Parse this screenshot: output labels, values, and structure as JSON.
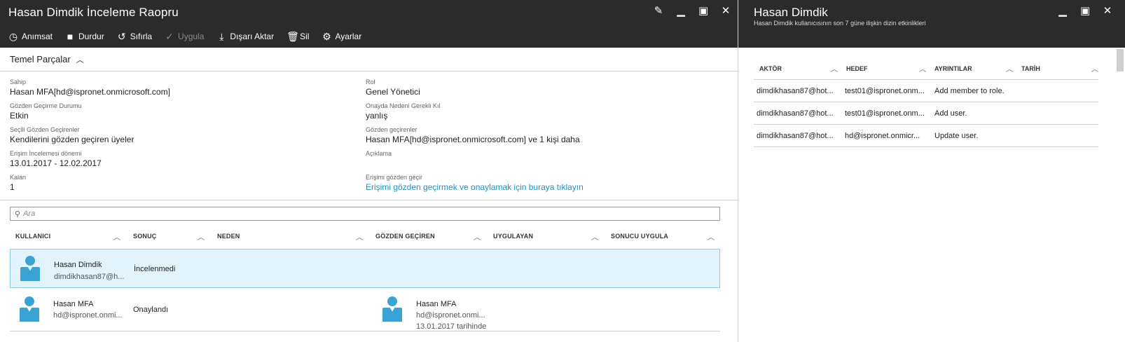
{
  "left": {
    "title": "Hasan Dimdik İnceleme Raopru",
    "toolbar": [
      {
        "icon": "clock-icon",
        "glyph": "◷",
        "label": "Anımsat",
        "enabled": true
      },
      {
        "icon": "stop-icon",
        "glyph": "■",
        "label": "Durdur",
        "enabled": true
      },
      {
        "icon": "reset-icon",
        "glyph": "↺",
        "label": "Sıfırla",
        "enabled": true
      },
      {
        "icon": "check-icon",
        "glyph": "✓",
        "label": "Uygula",
        "enabled": false
      },
      {
        "icon": "download-icon",
        "glyph": "⤓",
        "label": "Dışarı Aktar",
        "enabled": true
      },
      {
        "icon": "trash-icon",
        "glyph": "🗑",
        "label": "Sil",
        "enabled": true
      },
      {
        "icon": "gear-icon",
        "glyph": "⚙",
        "label": "Ayarlar",
        "enabled": true
      }
    ],
    "essentials_title": "Temel Parçalar",
    "essentials_left": [
      {
        "label": "Sahip",
        "value": "Hasan MFA[hd@ispronet.onmicrosoft.com]"
      },
      {
        "label": "Gözden Geçirme Durumu",
        "value": "Etkin"
      },
      {
        "label": "Seçili Gözden Geçirenler",
        "value": "Kendilerini gözden geçiren üyeler"
      },
      {
        "label": "Erişim İncelemesi dönemi",
        "value": "13.01.2017 - 12.02.2017"
      },
      {
        "label": "Kalan",
        "value": "1"
      }
    ],
    "essentials_right": [
      {
        "label": "Rol",
        "value": "Genel Yönetici"
      },
      {
        "label": "Onayda Nedeni Gerekli Kıl",
        "value": "yanlış"
      },
      {
        "label": "Gözden geçirenler",
        "value": "Hasan MFA[hd@ispronet.onmicrosoft.com] ve 1 kişi daha"
      },
      {
        "label": "Açıklama",
        "value": ""
      },
      {
        "label": "Erişimi gözden geçir",
        "value": "Erişimi gözden geçirmek ve onaylamak için buraya tıklayın"
      }
    ],
    "search_placeholder": "Ara",
    "columns": [
      "KULLANICI",
      "SONUÇ",
      "NEDEN",
      "GÖZDEN GEÇİREN",
      "UYGULAYAN",
      "SONUCU UYGULA"
    ],
    "rows": [
      {
        "user_name": "Hasan Dimdik",
        "user_email": "dimdikhasan87@h...",
        "result": "İncelenmedi",
        "reviewer_name": "",
        "reviewer_email": "",
        "reviewer_date": ""
      },
      {
        "user_name": "Hasan MFA",
        "user_email": "hd@ispronet.onmi...",
        "result": "Onaylandı",
        "reviewer_name": "Hasan MFA",
        "reviewer_email": "hd@ispronet.onmi...",
        "reviewer_date": "13.01.2017 tarihinde"
      }
    ]
  },
  "right": {
    "title": "Hasan Dimdik",
    "subtitle": "Hasan Dimdik kullanıcısının son 7 güne ilişkin dizin etkinlikleri",
    "columns": [
      "AKTÖR",
      "HEDEF",
      "AYRINTILAR",
      "TARİH"
    ],
    "rows": [
      {
        "actor": "dimdikhasan87@hot...",
        "target": "test01@ispronet.onm...",
        "details": "Add member to role.",
        "date": ""
      },
      {
        "actor": "dimdikhasan87@hot...",
        "target": "test01@ispronet.onm...",
        "details": "Add user.",
        "date": ""
      },
      {
        "actor": "dimdikhasan87@hot...",
        "target": "hd@ispronet.onmicr...",
        "details": "Update user.",
        "date": ""
      }
    ]
  },
  "colors": {
    "titlebar": "#2b2b2b",
    "accent": "#3aa3d5",
    "link": "#1a93c9",
    "selected_row": "#e3f3fb"
  }
}
